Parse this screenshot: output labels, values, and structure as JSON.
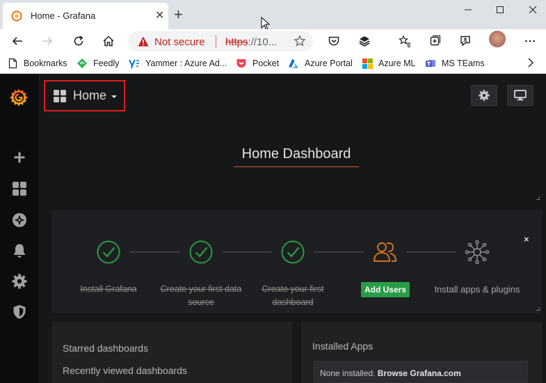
{
  "browser": {
    "tab_title": "Home - Grafana",
    "address": {
      "security_text": "Not secure",
      "url_scheme": "https",
      "url_rest": "://10..."
    },
    "bookmarks": [
      {
        "label": "Bookmarks",
        "icon": "page-icon"
      },
      {
        "label": "Feedly",
        "icon": "feedly-icon"
      },
      {
        "label": "Yammer : Azure Ad...",
        "icon": "yammer-icon"
      },
      {
        "label": "Pocket",
        "icon": "pocket-icon"
      },
      {
        "label": "Azure Portal",
        "icon": "azure-icon"
      },
      {
        "label": "Azure ML",
        "icon": "microsoft-icon"
      },
      {
        "label": "MS TEams",
        "icon": "teams-icon"
      }
    ]
  },
  "grafana": {
    "dashboard_picker_label": "Home",
    "home_title": "Home Dashboard",
    "steps": [
      {
        "label_line1": "Install Grafana",
        "label_line2": "",
        "state": "done"
      },
      {
        "label_line1": "Create your first data",
        "label_line2": "source",
        "state": "done"
      },
      {
        "label_line1": "Create your first",
        "label_line2": "dashboard",
        "state": "done"
      },
      {
        "label_line1": "Add Users",
        "label_line2": "",
        "state": "active"
      },
      {
        "label_line1": "Install apps & plugins",
        "label_line2": "",
        "state": "todo"
      }
    ],
    "close_glyph": "×",
    "left_panel": {
      "starred": "Starred dashboards",
      "recent": "Recently viewed dashboards"
    },
    "right_panel": {
      "title": "Installed Apps",
      "none_text": "None installed.",
      "browse_text": "Browse Grafana.com"
    }
  },
  "colors": {
    "accent_orange": "#f47d1d",
    "success_green": "#299c46",
    "highlight_red": "#e01c1c",
    "danger_red": "#c5221f"
  }
}
